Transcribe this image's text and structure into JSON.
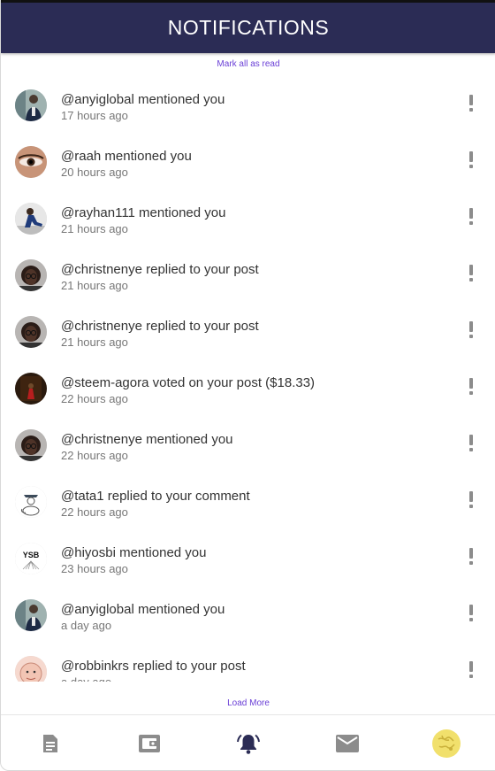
{
  "header": {
    "title": "NOTIFICATIONS"
  },
  "actions": {
    "mark_all_read": "Mark all as read",
    "load_more": "Load More"
  },
  "colors": {
    "header_bg": "#2b2c55",
    "link": "#6a3fd6",
    "active_icon": "#2b2c55",
    "inactive_icon": "#8c8c8c"
  },
  "notifications": [
    {
      "text": "@anyiglobal mentioned you",
      "time": "17 hours ago",
      "avatar": "man-dark-jacket"
    },
    {
      "text": "@raah mentioned you",
      "time": "20 hours ago",
      "avatar": "eye-closeup"
    },
    {
      "text": "@rayhan111 mentioned you",
      "time": "21 hours ago",
      "avatar": "man-seated"
    },
    {
      "text": "@christnenye replied to your post",
      "time": "21 hours ago",
      "avatar": "woman-glasses"
    },
    {
      "text": "@christnenye replied to your post",
      "time": "21 hours ago",
      "avatar": "woman-glasses"
    },
    {
      "text": "@steem-agora voted on your post ($18.33)",
      "time": "22 hours ago",
      "avatar": "dark-red-figure"
    },
    {
      "text": "@christnenye mentioned you",
      "time": "22 hours ago",
      "avatar": "woman-glasses"
    },
    {
      "text": "@tata1 replied to your comment",
      "time": "22 hours ago",
      "avatar": "sketch-figure"
    },
    {
      "text": "@hiyosbi mentioned you",
      "time": "23 hours ago",
      "avatar": "ysb-logo"
    },
    {
      "text": "@anyiglobal mentioned you",
      "time": "a day ago",
      "avatar": "man-dark-jacket"
    },
    {
      "text": "@robbinkrs replied to your post",
      "time": "a day ago",
      "avatar": "cartoon-face"
    }
  ],
  "ysb_logo_text": "YSB",
  "nav": [
    {
      "icon": "document-icon",
      "active": false
    },
    {
      "icon": "wallet-icon",
      "active": false
    },
    {
      "icon": "bell-ringing-icon",
      "active": true
    },
    {
      "icon": "mail-icon",
      "active": false
    },
    {
      "icon": "profile-avatar-icon",
      "active": false
    }
  ]
}
